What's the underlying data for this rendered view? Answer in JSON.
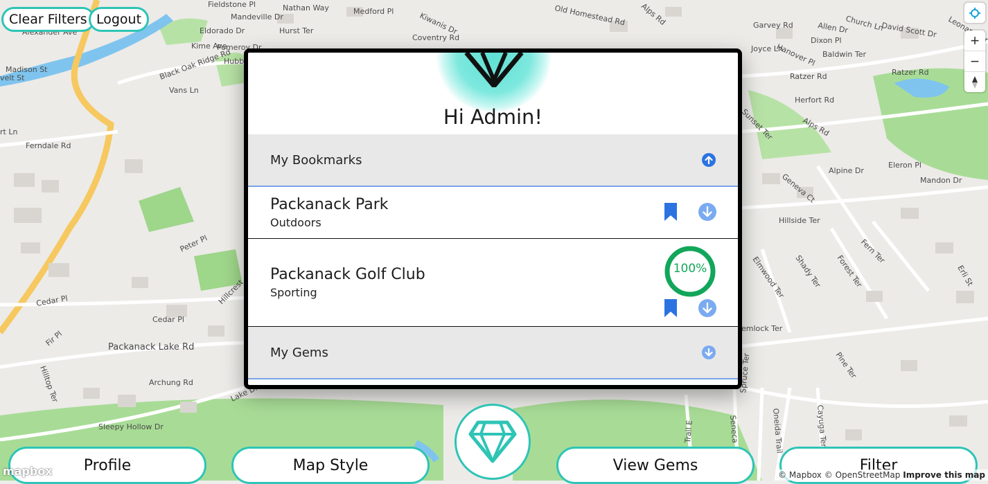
{
  "top_buttons": {
    "clear_filters": "Clear Filters",
    "logout": "Logout"
  },
  "bottom_nav": {
    "profile": "Profile",
    "map_style": "Map Style",
    "view_gems": "View Gems",
    "filter": "Filter"
  },
  "modal": {
    "greeting": "Hi Admin!",
    "bookmarks_header": "My Bookmarks",
    "bookmarks": [
      {
        "title": "Packanack Park",
        "category": "Outdoors"
      },
      {
        "title": "Packanack Golf Club",
        "category": "Sporting",
        "progress_label": "100%",
        "progress": 1.0
      }
    ],
    "gems_header": "My Gems"
  },
  "map_labels": [
    "Fieldstone Pl",
    "Nathan Way",
    "Mandeville Dr",
    "Medford Pl",
    "Kiwanis Dr",
    "Old Homestead Rd",
    "Alps Rd",
    "Garvey Rd",
    "Allen Dr",
    "Church Ln",
    "David Scott Dr",
    "Leonard Ter",
    "Alexander Ave",
    "Eldorado Dr",
    "Hurst Ter",
    "Coventry Rd",
    "Kime Ave",
    "Joyce Ln",
    "Hanover Pl",
    "Dixon Pl",
    "Baldwin Ter",
    "Black Oak Ridge Rd",
    "Hubbard",
    "Pomeroy Dr",
    "Madison St",
    "velt St",
    "Vans Ln",
    "Ratzer Rd",
    "Ratzer Rd",
    "Herfort Rd",
    "Sunset Ter",
    "Alps Rd",
    "rt Ln",
    "Ferndale Rd",
    "Alpine Dr",
    "Eleron Pl",
    "Geneva Ct",
    "Mandon Dr",
    "Hillside Ter",
    "Peter Pl",
    "Fern Ter",
    "Elmwood Ter",
    "Shady Ter",
    "Forest Ter",
    "Erli St",
    "Cedar Pl",
    "Cedar Pl",
    "Hillcrest",
    "Fir Pl",
    "Packanack Lake Rd",
    "Hilltop Ter",
    "Archung Rd",
    "Lake Dr",
    "emlock Ter",
    "Pine Ter",
    "Spruce Ter",
    "Sleepy Hollow Dr",
    "Trail E",
    "Seneca",
    "Oneida Trail",
    "Cayuga Ter"
  ],
  "attribution": {
    "mapbox": "© Mapbox",
    "osm": "© OpenStreetMap",
    "improve": "Improve this map"
  },
  "mapbox_logo": "mapbox",
  "icons": {
    "bookmark": "bookmark-icon",
    "arrow_up": "arrow-up-circle-icon",
    "arrow_down": "arrow-down-circle-icon",
    "gem": "gem-icon",
    "locate": "geolocate-icon",
    "zoom_in": "plus-icon",
    "zoom_out": "minus-icon",
    "compass": "compass-icon"
  },
  "colors": {
    "accent_teal": "#2ec4b6",
    "blue_icon": "#2b73e0",
    "progress_green": "#12a65a",
    "modal_border": "#000000"
  }
}
